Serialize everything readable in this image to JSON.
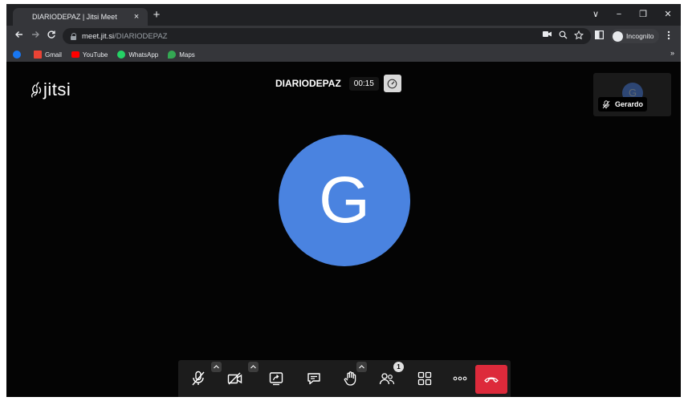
{
  "browser": {
    "tab_title": "DIARIODEPAZ | Jitsi Meet",
    "tab_close": "×",
    "new_tab": "+",
    "window_controls": {
      "dropdown": "∨",
      "minimize": "−",
      "restore": "❐",
      "close": "✕"
    },
    "url_host": "meet.jit.si",
    "url_path": "/DIARIODEPAZ",
    "incognito_label": "Incognito",
    "bookmarks": [
      {
        "label": "Gmail",
        "color": "#ea4335"
      },
      {
        "label": "YouTube",
        "color": "#ff0000"
      },
      {
        "label": "WhatsApp",
        "color": "#25d366"
      },
      {
        "label": "Maps",
        "color": "#34a853"
      }
    ],
    "bookmarks_more": "»"
  },
  "meeting": {
    "logo_text": "jitsi",
    "room_name": "DIARIODEPAZ",
    "timer": "00:15",
    "thumbnail": {
      "avatar_initial": "G",
      "name": "Gerardo"
    },
    "main_avatar_initial": "G",
    "avatar_color": "#4a83e0",
    "hangup_color": "#dd2a3b",
    "participants_count": "1"
  }
}
